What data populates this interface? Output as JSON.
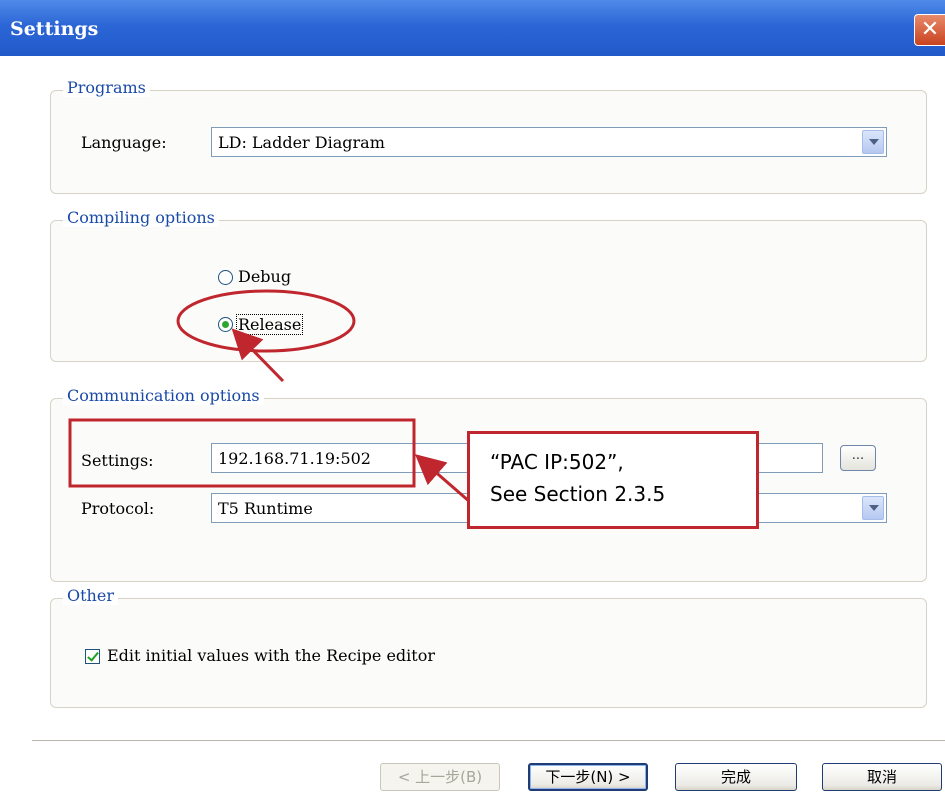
{
  "window": {
    "title": "Settings",
    "close_glyph": "✕"
  },
  "programs": {
    "legend": "Programs",
    "language_label": "Language:",
    "language_value": "LD: Ladder Diagram"
  },
  "compiling": {
    "legend": "Compiling options",
    "debug_label": "Debug",
    "release_label": "Release",
    "selected": "Release"
  },
  "communication": {
    "legend": "Communication options",
    "settings_label": "Settings:",
    "settings_value": "192.168.71.19:502",
    "browse_label": "...",
    "protocol_label": "Protocol:",
    "protocol_value": "T5 Runtime"
  },
  "other": {
    "legend": "Other",
    "recipe_label": "Edit initial values with the Recipe editor",
    "recipe_checked": true
  },
  "annotation": {
    "line1": "“PAC IP:502”,",
    "line2": "See Section 2.3.5",
    "color": "#c0262d"
  },
  "wizard_buttons": {
    "back": "< 上一步(B)",
    "next": "下一步(N) >",
    "finish": "完成",
    "cancel": "取消"
  },
  "colors": {
    "title_bar": "#2c66d6",
    "legend_text": "#1a4aa8",
    "annotation_red": "#c0262d"
  }
}
